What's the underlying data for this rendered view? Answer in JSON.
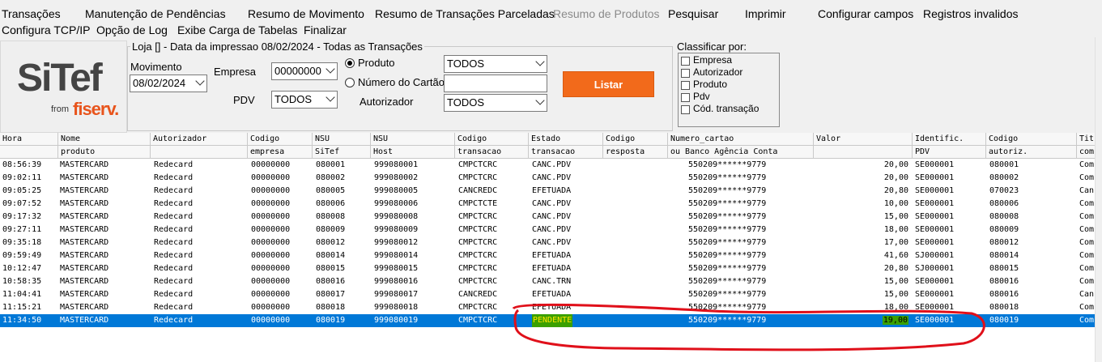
{
  "menu": {
    "row1": [
      "Transações",
      "Manutenção de Pendências",
      "Resumo de Movimento",
      "Resumo de Transações Parceladas",
      "Resumo de Produtos",
      "Pesquisar",
      "Imprimir",
      "Configurar campos",
      "Registros invalidos"
    ],
    "row2": [
      "Configura TCP/IP",
      "Opção de Log",
      "Exibe Carga de Tabelas",
      "Finalizar"
    ],
    "disabled_item": "Resumo de Produtos"
  },
  "logo": {
    "brand": "SiTef",
    "from": "from",
    "company": "fiserv."
  },
  "filter": {
    "group_title": "Loja [] - Data da impressao 08/02/2024 - Todas as Transações",
    "movimento_label": "Movimento",
    "movimento_value": "08/02/2024",
    "empresa_label": "Empresa",
    "empresa_value": "00000000",
    "pdv_label": "PDV",
    "pdv_value": "TODOS",
    "produto_label": "Produto",
    "produto_value": "TODOS",
    "cartao_label": "Número do Cartão",
    "cartao_value": "",
    "autorizador_label": "Autorizador",
    "autorizador_value": "TODOS",
    "listar_label": "Listar",
    "selected_radio": "Produto"
  },
  "sort": {
    "title": "Classificar por:",
    "options": [
      "Empresa",
      "Autorizador",
      "Produto",
      "Pdv",
      "Cód. transação"
    ]
  },
  "grid": {
    "headers_top": [
      "Hora",
      "Nome",
      "Autorizador",
      "Codigo",
      "NSU",
      "NSU",
      "Codigo",
      "Estado",
      "Codigo",
      "Numero_cartao",
      "Valor",
      "Identific.",
      "Codigo",
      "Tit"
    ],
    "headers_bottom": [
      "",
      "produto",
      "",
      "empresa",
      "SiTef",
      "Host",
      "transacao",
      "transacao",
      "resposta",
      "ou Banco Agência Conta",
      "",
      "PDV",
      "autoriz.",
      "com"
    ],
    "rows": [
      [
        "08:56:39",
        "MASTERCARD",
        "Redecard",
        "00000000",
        "080001",
        "999080001",
        "CMPCTCRC",
        "CANC.PDV",
        "",
        "550209******9779",
        "20,00",
        "SE000001",
        "080001",
        "Com"
      ],
      [
        "09:02:11",
        "MASTERCARD",
        "Redecard",
        "00000000",
        "080002",
        "999080002",
        "CMPCTCRC",
        "CANC.PDV",
        "",
        "550209******9779",
        "20,00",
        "SE000001",
        "080002",
        "Com"
      ],
      [
        "09:05:25",
        "MASTERCARD",
        "Redecard",
        "00000000",
        "080005",
        "999080005",
        "CANCREDC",
        "EFETUADA",
        "",
        "550209******9779",
        "20,80",
        "SE000001",
        "070023",
        "Canc"
      ],
      [
        "09:07:52",
        "MASTERCARD",
        "Redecard",
        "00000000",
        "080006",
        "999080006",
        "CMPCTCTE",
        "CANC.PDV",
        "",
        "550209******9779",
        "10,00",
        "SE000001",
        "080006",
        "Com"
      ],
      [
        "09:17:32",
        "MASTERCARD",
        "Redecard",
        "00000000",
        "080008",
        "999080008",
        "CMPCTCRC",
        "CANC.PDV",
        "",
        "550209******9779",
        "15,00",
        "SE000001",
        "080008",
        "Com"
      ],
      [
        "09:27:11",
        "MASTERCARD",
        "Redecard",
        "00000000",
        "080009",
        "999080009",
        "CMPCTCRC",
        "CANC.PDV",
        "",
        "550209******9779",
        "18,00",
        "SE000001",
        "080009",
        "Com"
      ],
      [
        "09:35:18",
        "MASTERCARD",
        "Redecard",
        "00000000",
        "080012",
        "999080012",
        "CMPCTCRC",
        "CANC.PDV",
        "",
        "550209******9779",
        "17,00",
        "SE000001",
        "080012",
        "Com"
      ],
      [
        "09:59:49",
        "MASTERCARD",
        "Redecard",
        "00000000",
        "080014",
        "999080014",
        "CMPCTCRC",
        "EFETUADA",
        "",
        "550209******9779",
        "41,60",
        "SJ000001",
        "080014",
        "Com"
      ],
      [
        "10:12:47",
        "MASTERCARD",
        "Redecard",
        "00000000",
        "080015",
        "999080015",
        "CMPCTCRC",
        "EFETUADA",
        "",
        "550209******9779",
        "20,80",
        "SJ000001",
        "080015",
        "Com"
      ],
      [
        "10:58:35",
        "MASTERCARD",
        "Redecard",
        "00000000",
        "080016",
        "999080016",
        "CMPCTCRC",
        "CANC.TRN",
        "",
        "550209******9779",
        "15,00",
        "SE000001",
        "080016",
        "Com"
      ],
      [
        "11:04:41",
        "MASTERCARD",
        "Redecard",
        "00000000",
        "080017",
        "999080017",
        "CANCREDC",
        "EFETUADA",
        "",
        "550209******9779",
        "15,00",
        "SE000001",
        "080016",
        "Canc"
      ],
      [
        "11:15:21",
        "MASTERCARD",
        "Redecard",
        "00000000",
        "080018",
        "999080018",
        "CMPCTCRC",
        "EFETUADA",
        "",
        "550209******9779",
        "18,00",
        "SE000001",
        "080018",
        "Com"
      ],
      [
        "11:34:50",
        "MASTERCARD",
        "Redecard",
        "00000000",
        "080019",
        "999080019",
        "CMPCTCRC",
        "PENDENTE",
        "",
        "550209******9779",
        "19,00",
        "SE000001",
        "080019",
        "Com"
      ]
    ],
    "selected_row": 12,
    "colors": {
      "selection": "#0078d7",
      "highlight": "#3aa000",
      "annotation": "#e0101a"
    }
  }
}
